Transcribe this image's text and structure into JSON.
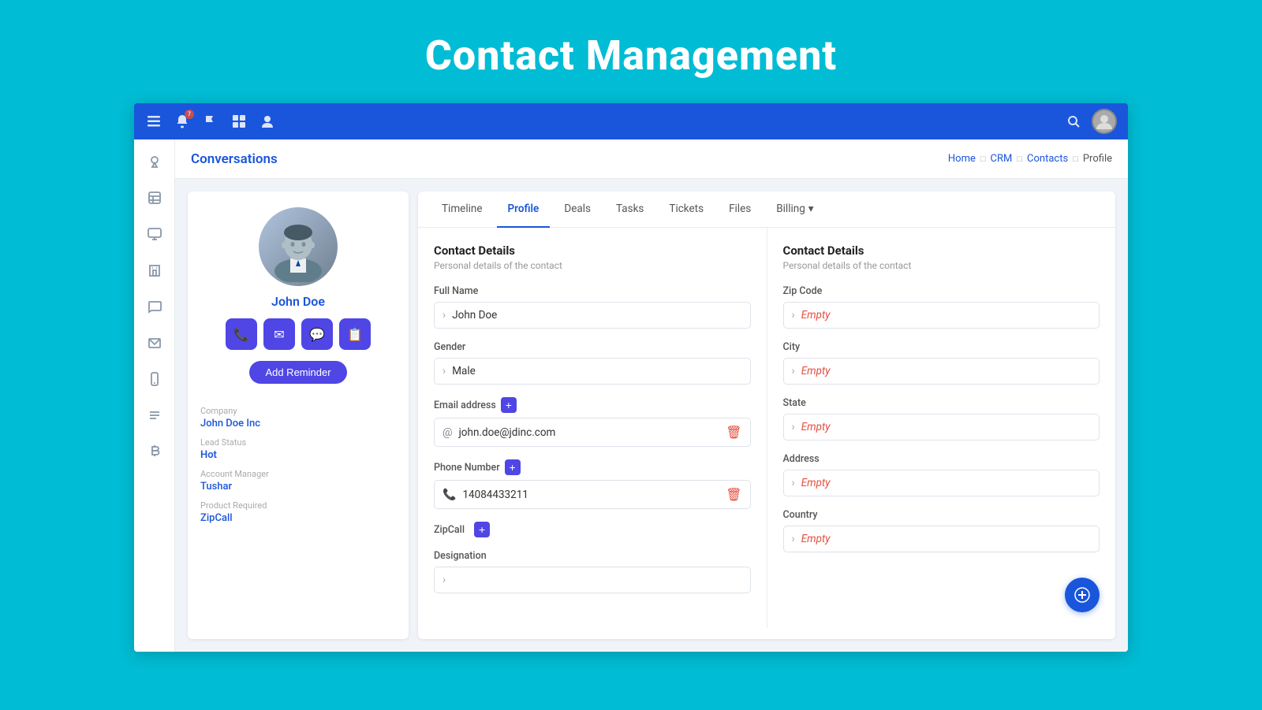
{
  "page": {
    "title": "Contact Management",
    "background": "#00BCD4"
  },
  "topNav": {
    "icons": [
      "menu-icon",
      "notification-icon",
      "flag-icon",
      "grid-icon",
      "user-icon"
    ],
    "notificationCount": "7",
    "searchLabel": "Search",
    "avatarLabel": "User Avatar"
  },
  "sidebar": {
    "items": [
      {
        "name": "location-icon",
        "label": "Location"
      },
      {
        "name": "contacts-icon",
        "label": "Contacts"
      },
      {
        "name": "monitor-icon",
        "label": "Monitor"
      },
      {
        "name": "building-icon",
        "label": "Building"
      },
      {
        "name": "chat-icon",
        "label": "Chat"
      },
      {
        "name": "mail-icon",
        "label": "Mail"
      },
      {
        "name": "mobile-icon",
        "label": "Mobile"
      },
      {
        "name": "text-icon",
        "label": "Text"
      },
      {
        "name": "bitcoin-icon",
        "label": "Bitcoin"
      }
    ]
  },
  "header": {
    "title": "Conversations",
    "breadcrumb": {
      "home": "Home",
      "crm": "CRM",
      "contacts": "Contacts",
      "profile": "Profile"
    }
  },
  "contactCard": {
    "name": "John Doe",
    "actions": [
      {
        "name": "phone-action",
        "icon": "📞"
      },
      {
        "name": "email-action",
        "icon": "✉️"
      },
      {
        "name": "chat-action",
        "icon": "💬"
      },
      {
        "name": "note-action",
        "icon": "📋"
      }
    ],
    "addReminderLabel": "Add Reminder",
    "meta": {
      "company": {
        "label": "Company",
        "value": "John Doe Inc"
      },
      "leadStatus": {
        "label": "Lead Status",
        "value": "Hot"
      },
      "accountManager": {
        "label": "Account Manager",
        "value": "Tushar"
      },
      "productRequired": {
        "label": "Product Required",
        "value": "ZipCall"
      }
    }
  },
  "tabs": [
    {
      "label": "Timeline",
      "id": "timeline",
      "active": false
    },
    {
      "label": "Profile",
      "id": "profile",
      "active": true
    },
    {
      "label": "Deals",
      "id": "deals",
      "active": false
    },
    {
      "label": "Tasks",
      "id": "tasks",
      "active": false
    },
    {
      "label": "Tickets",
      "id": "tickets",
      "active": false
    },
    {
      "label": "Files",
      "id": "files",
      "active": false
    },
    {
      "label": "Billing",
      "id": "billing",
      "active": false,
      "hasDropdown": true
    }
  ],
  "leftDetails": {
    "sectionTitle": "Contact Details",
    "sectionSub": "Personal details of the contact",
    "fields": [
      {
        "label": "Full Name",
        "value": "John Doe",
        "type": "text",
        "hasChevron": true
      },
      {
        "label": "Gender",
        "value": "Male",
        "type": "text",
        "hasChevron": true
      },
      {
        "label": "Email address",
        "value": "john.doe@jdinc.com",
        "type": "email",
        "hasAddBtn": true,
        "hasDel": true
      },
      {
        "label": "Phone Number",
        "value": "14084433211",
        "type": "phone",
        "hasAddBtn": true,
        "hasDel": true
      },
      {
        "label": "ZipCall",
        "value": "",
        "type": "zipcall",
        "hasAddBtn": true
      },
      {
        "label": "Designation",
        "value": "",
        "type": "text",
        "hasChevron": true
      }
    ]
  },
  "rightDetails": {
    "sectionTitle": "Contact Details",
    "sectionSub": "Personal details of the contact",
    "fields": [
      {
        "label": "Zip Code",
        "value": "Empty",
        "isEmpty": true
      },
      {
        "label": "City",
        "value": "Empty",
        "isEmpty": true
      },
      {
        "label": "State",
        "value": "Empty",
        "isEmpty": true
      },
      {
        "label": "Address",
        "value": "Empty",
        "isEmpty": true
      },
      {
        "label": "Country",
        "value": "Empty",
        "isEmpty": true
      }
    ]
  }
}
